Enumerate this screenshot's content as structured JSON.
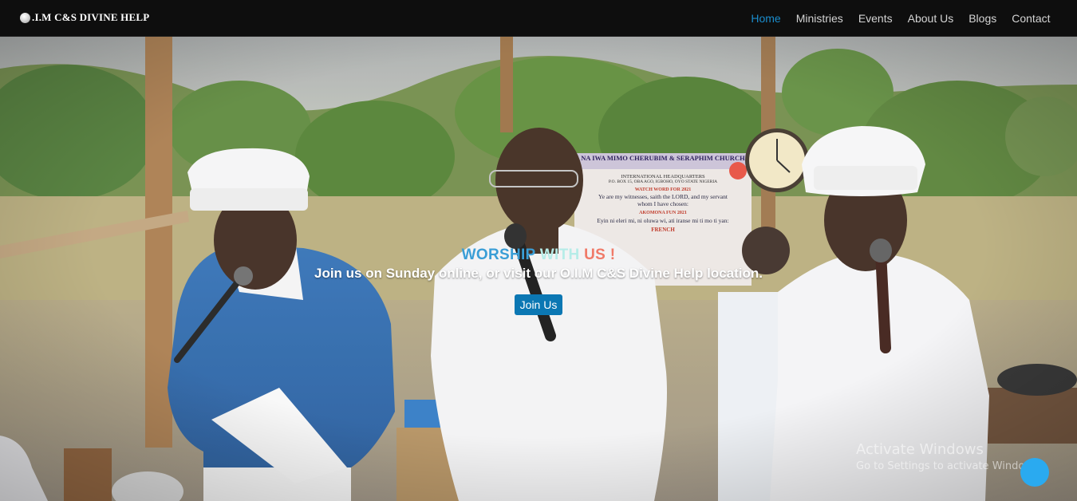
{
  "brand": {
    "logo_icon": "globe-logo-icon",
    "name": ".I.M C&S DIVINE HELP"
  },
  "nav": {
    "items": [
      {
        "label": "Home",
        "active": true
      },
      {
        "label": "Ministries",
        "active": false
      },
      {
        "label": "Events",
        "active": false
      },
      {
        "label": "About Us",
        "active": false
      },
      {
        "label": "Blogs",
        "active": false
      },
      {
        "label": "Contact",
        "active": false
      }
    ],
    "active_color": "#1a8ccc"
  },
  "hero": {
    "title_parts": [
      "WORSHIP",
      "WITH",
      "US !"
    ],
    "subtitle": "Join us on Sunday online, or visit our O.I.M C&S Divine Help location.",
    "button_label": "Join Us",
    "button_color": "#0b77b3"
  },
  "banner_sign": {
    "heading": "NA IWA MIMO CHERUBIM & SERAPHIM CHURCH",
    "subheading": "INTERNATIONAL HEADQUARTERS",
    "address": "P.O. BOX 15, OBA AGO, IGBOHO, OYO STATE NIGERIA",
    "watch_word": "WATCH WORD FOR 2021",
    "english": "Ye are my witnesses, saith the LORD, and my servant whom I have chosen:",
    "akomona": "AKOMONA FUN 2021",
    "yoruba": "Eyin ni eleri mi, ni oluwa wi, ati iranse mi ti mo ti yan:",
    "french": "FRENCH"
  },
  "watermark": {
    "title": "Activate Windows",
    "subtitle": "Go to Settings to activate Windows."
  },
  "scroll_button": {
    "icon": "chat-bubble-icon",
    "color": "#2aaaf0"
  }
}
